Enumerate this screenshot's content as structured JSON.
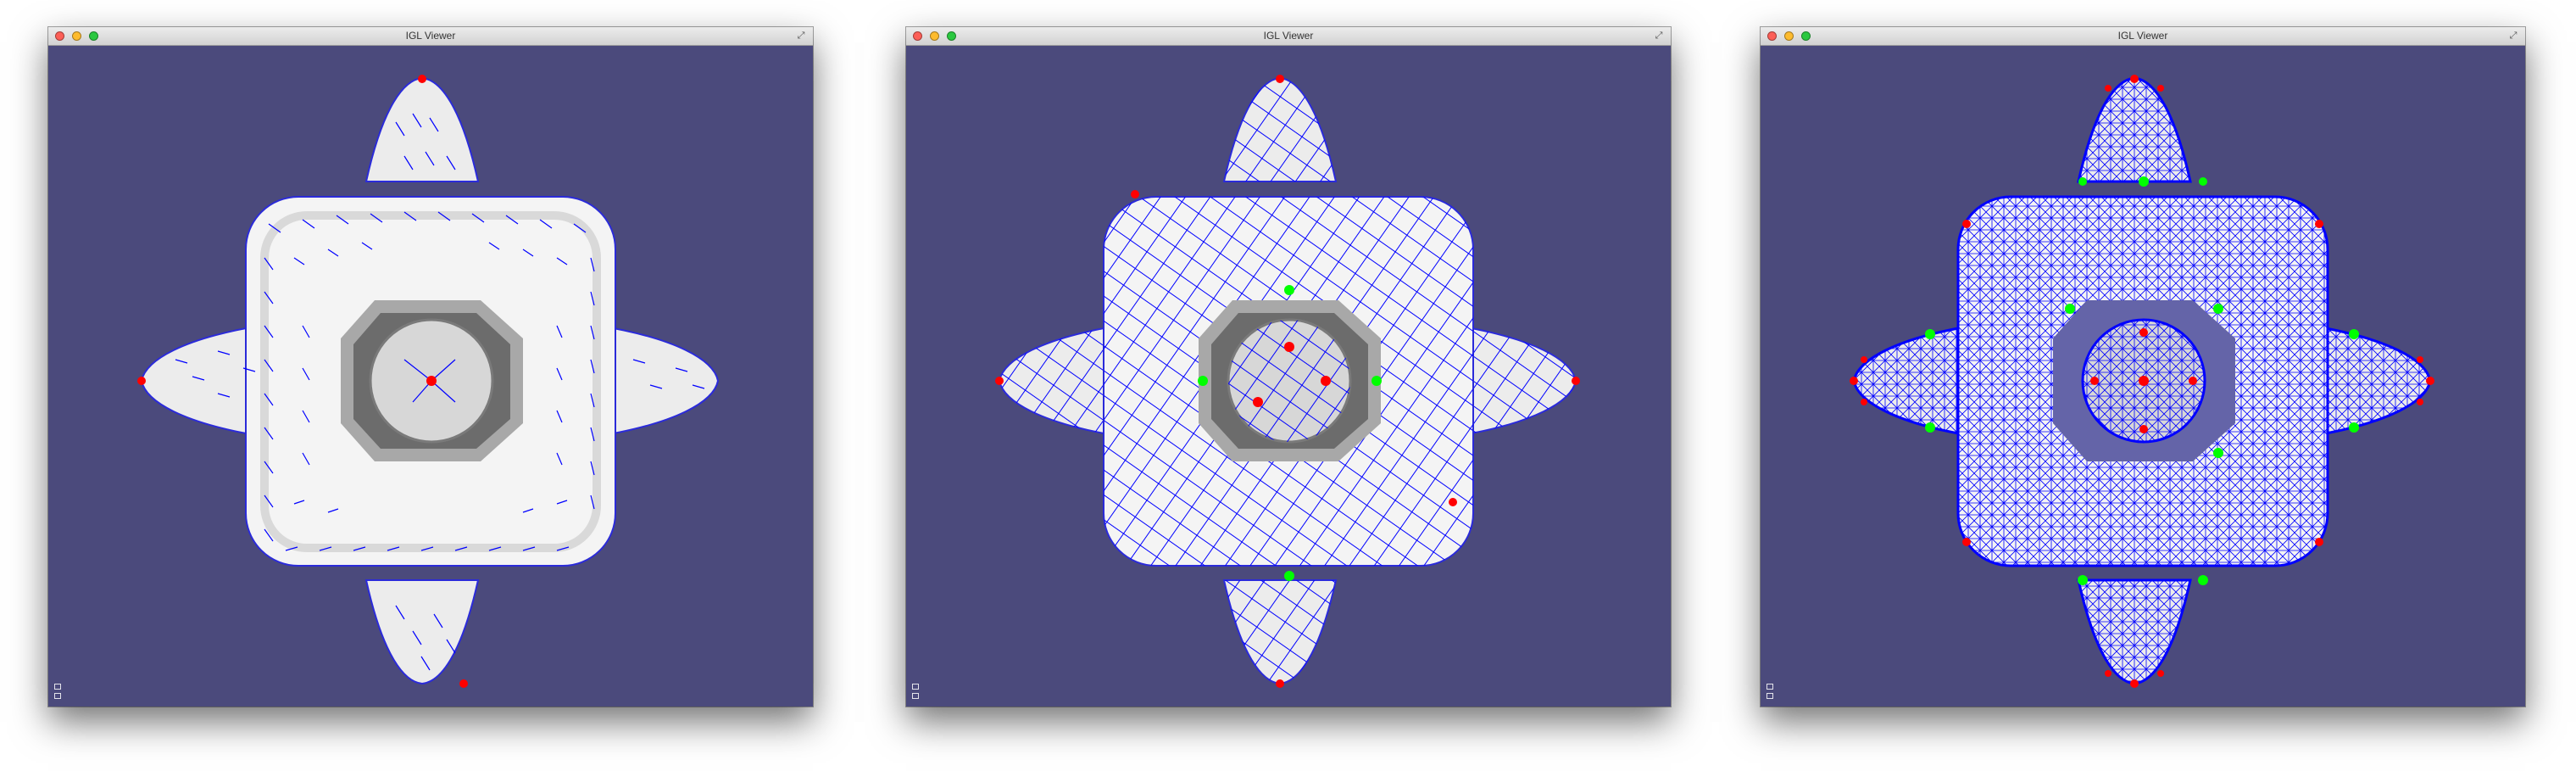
{
  "windows": [
    {
      "title": "IGL Viewer",
      "variant": "direction-field"
    },
    {
      "title": "IGL Viewer",
      "variant": "cross-field"
    },
    {
      "title": "IGL Viewer",
      "variant": "dense-field"
    }
  ],
  "colors": {
    "viewport_background": "#4b4a7c",
    "mesh_fill": "#f2f2f2",
    "mesh_shade": "#c8c8c8",
    "field_lines": "#0000ff",
    "singularity_positive": "#ff0000",
    "singularity_negative": "#00ff00"
  },
  "icons": {
    "close": "close-button",
    "minimize": "minimize-button",
    "zoom": "zoom-button",
    "fullscreen": "fullscreen-icon",
    "hud": "viewer-hud-icon"
  }
}
